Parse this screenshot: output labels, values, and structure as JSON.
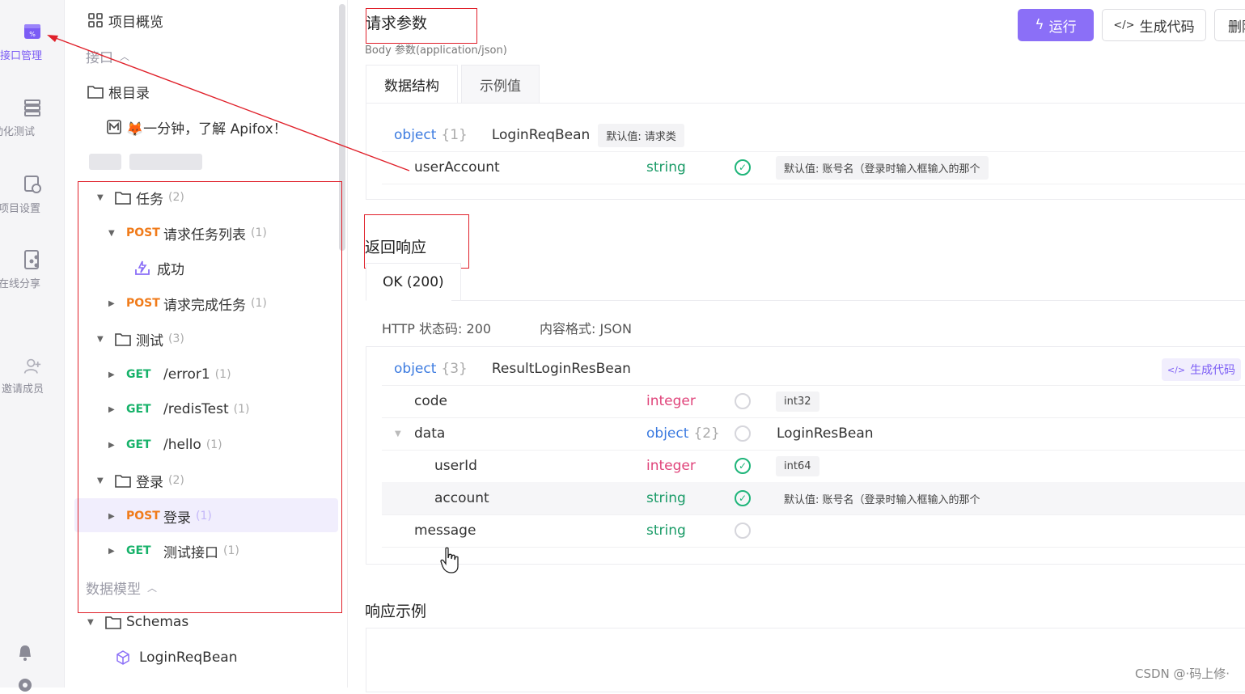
{
  "rail": {
    "items": [
      {
        "label": "接口管理",
        "icon": "api-management-icon",
        "active": true
      },
      {
        "label": "自动化测试",
        "icon": "automation-test-icon",
        "active": false
      },
      {
        "label": "项目设置",
        "icon": "project-settings-icon",
        "active": false
      },
      {
        "label": "在线分享",
        "icon": "online-share-icon",
        "active": false
      },
      {
        "label": "邀请成员",
        "icon": "invite-member-icon",
        "active": false
      }
    ]
  },
  "tree": {
    "overview": "项目概览",
    "api_section": "接口",
    "root": "根目录",
    "intro_doc": "🦊一分钟，了解 Apifox！",
    "folders": {
      "task": {
        "name": "任务",
        "count": "(2)"
      },
      "test": {
        "name": "测试",
        "count": "(3)"
      },
      "login": {
        "name": "登录",
        "count": "(2)"
      }
    },
    "apis": {
      "task_list": {
        "method": "POST",
        "name": "请求任务列表",
        "count": "(1)"
      },
      "task_list_case": "成功",
      "task_complete": {
        "method": "POST",
        "name": "请求完成任务",
        "count": "(1)"
      },
      "error1": {
        "method": "GET",
        "name": "/error1",
        "count": "(1)"
      },
      "redis": {
        "method": "GET",
        "name": "/redisTest",
        "count": "(1)"
      },
      "hello": {
        "method": "GET",
        "name": "/hello",
        "count": "(1)"
      },
      "login": {
        "method": "POST",
        "name": "登录",
        "count": "(1)"
      },
      "test_api": {
        "method": "GET",
        "name": "测试接口",
        "count": "(1)"
      }
    },
    "models_section": "数据模型",
    "schemas": "Schemas",
    "schema_item": "LoginReqBean"
  },
  "main": {
    "request_title": "请求参数",
    "body_label": "Body 参数(application/json)",
    "buttons": {
      "run": "运行",
      "gen_code": "生成代码",
      "delete": "删除"
    },
    "req_tabs": [
      "数据结构",
      "示例值"
    ],
    "req_root": {
      "type": "object",
      "brace": "{1}",
      "name": "LoginReqBean",
      "default": "默认值: 请求类"
    },
    "req_fields": [
      {
        "name": "userAccount",
        "type": "string",
        "required": true,
        "tag": "默认值: 账号名（登录时输入框输入的那个"
      }
    ],
    "response_title": "返回响应",
    "resp_tab": "OK (200)",
    "status_code": "HTTP 状态码: 200",
    "content_type": "内容格式: JSON",
    "resp_root": {
      "type": "object",
      "brace": "{3}",
      "name": "ResultLoginResBean"
    },
    "gen_code_small": "生成代码",
    "resp_fields": {
      "code": {
        "name": "code",
        "type": "integer",
        "required": false,
        "tag": "int32"
      },
      "data": {
        "name": "data",
        "type": "object",
        "brace": "{2}",
        "required": false,
        "ref": "LoginResBean"
      },
      "userId": {
        "name": "userId",
        "type": "integer",
        "required": true,
        "tag": "int64"
      },
      "account": {
        "name": "account",
        "type": "string",
        "required": true,
        "tag": "默认值: 账号名（登录时输入框输入的那个"
      },
      "message": {
        "name": "message",
        "type": "string",
        "required": false
      }
    },
    "example_title": "响应示例"
  },
  "watermark": "CSDN @·码上修·",
  "colors": {
    "accent": "#8b6ff7",
    "post": "#f07b1a",
    "get": "#17b26a",
    "annotation": "#e0202a"
  }
}
